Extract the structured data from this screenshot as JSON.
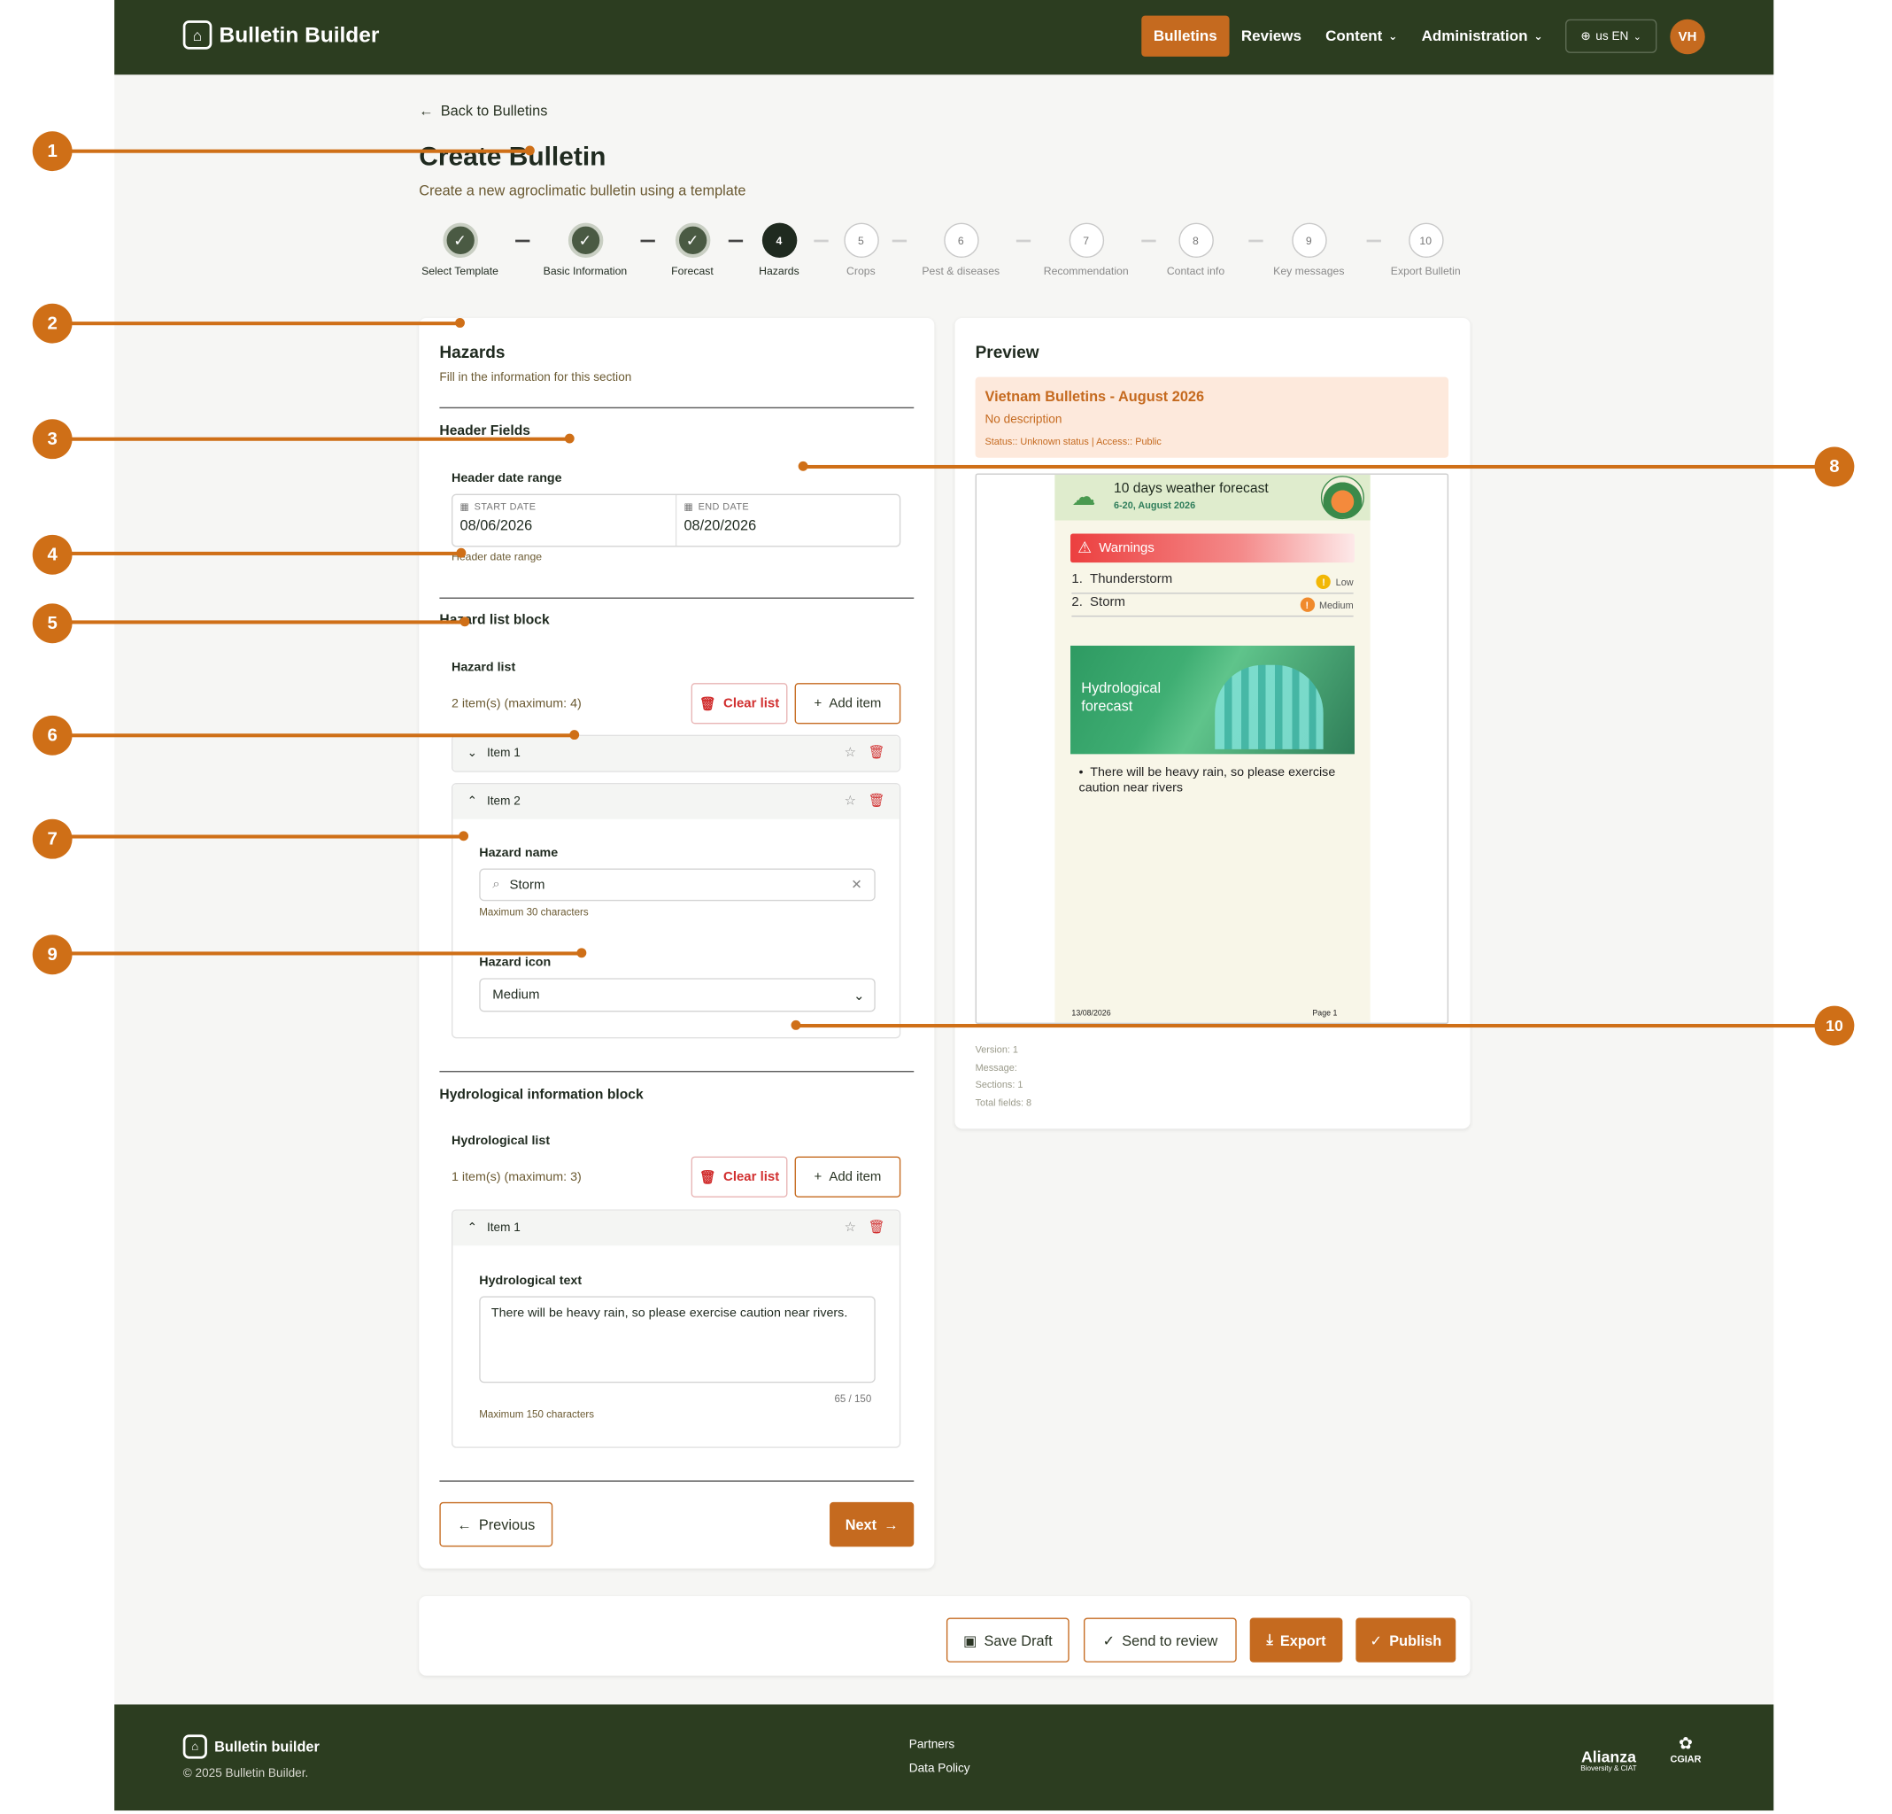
{
  "header": {
    "brand": "Bulletin Builder",
    "nav": [
      {
        "label": "Bulletins",
        "active": true
      },
      {
        "label": "Reviews"
      },
      {
        "label": "Content",
        "dropdown": true
      },
      {
        "label": "Administration",
        "dropdown": true
      }
    ],
    "language": "us EN",
    "avatar": "VH"
  },
  "page": {
    "back": "Back to Bulletins",
    "title": "Create Bulletin",
    "subtitle": "Create a new agroclimatic bulletin using a template"
  },
  "stepper": [
    {
      "label": "Select Template",
      "state": "done"
    },
    {
      "label": "Basic Information",
      "state": "done"
    },
    {
      "label": "Forecast",
      "state": "done"
    },
    {
      "number": "4",
      "label": "Hazards",
      "state": "current"
    },
    {
      "number": "5",
      "label": "Crops",
      "state": "todo"
    },
    {
      "number": "6",
      "label": "Pest & diseases",
      "state": "todo"
    },
    {
      "number": "7",
      "label": "Recommendation",
      "state": "todo"
    },
    {
      "number": "8",
      "label": "Contact info",
      "state": "todo"
    },
    {
      "number": "9",
      "label": "Key messages",
      "state": "todo"
    },
    {
      "number": "10",
      "label": "Export Bulletin",
      "state": "todo"
    }
  ],
  "form": {
    "section_title": "Hazards",
    "section_hint": "Fill in the information for this section",
    "header_fields_title": "Header Fields",
    "header_range_label": "Header date range",
    "start_label": "START DATE",
    "start_value": "08/06/2026",
    "end_label": "END DATE",
    "end_value": "08/20/2026",
    "header_range_hint": "Header date range",
    "hazard_block_title": "Hazard list block",
    "hazard_list_label": "Hazard list",
    "hazard_count": "2 item(s) (maximum: 4)",
    "clear_label": "Clear list",
    "add_label": "Add item",
    "hazard_items": [
      {
        "label": "Item 1",
        "expanded": false
      },
      {
        "label": "Item 2",
        "expanded": true
      }
    ],
    "hazard_name_label": "Hazard name",
    "hazard_name_value": "Storm",
    "hazard_name_hint": "Maximum 30 characters",
    "hazard_icon_label": "Hazard icon",
    "hazard_icon_value": "Medium",
    "hydro_block_title": "Hydrological information block",
    "hydro_list_label": "Hydrological list",
    "hydro_count": "1 item(s) (maximum: 3)",
    "hydro_item_label": "Item 1",
    "hydro_text_label": "Hydrological text",
    "hydro_text_value": "There will be heavy rain, so please exercise caution near rivers.",
    "hydro_counter": "65 / 150",
    "hydro_hint": "Maximum 150 characters",
    "prev_label": "Previous",
    "next_label": "Next"
  },
  "preview": {
    "title": "Preview",
    "bulletin_title": "Vietnam Bulletins - August 2026",
    "description": "No description",
    "status": "Status:: Unknown status | Access:: Public",
    "doc": {
      "heading": "10 days weather forecast",
      "dates": "6-20, August 2026",
      "warnings_label": "Warnings",
      "hazards": [
        {
          "num": "1.",
          "name": "Thunderstorm",
          "level": "Low",
          "color": "#f2b705"
        },
        {
          "num": "2.",
          "name": "Storm",
          "level": "Medium",
          "color": "#f08a2c"
        }
      ],
      "hydro_title": "Hydrological forecast",
      "hydro_bullet": "There will be heavy rain, so please exercise caution near rivers",
      "footer_date": "13/08/2026",
      "footer_page": "Page 1"
    },
    "info": [
      "Version: 1",
      "Message:",
      "Sections: 1",
      "Total fields: 8"
    ]
  },
  "actions": {
    "save": "Save Draft",
    "review": "Send to review",
    "export": "Export",
    "publish": "Publish"
  },
  "footer": {
    "brand": "Bulletin builder",
    "copyright": "© 2025 Bulletin Builder.",
    "links": [
      "Partners",
      "Data Policy"
    ],
    "partner1_name": "Alianza",
    "partner1_sub": "Bioversity & CIAT",
    "partner2": "CGIAR"
  },
  "annotations": [
    "1",
    "2",
    "3",
    "4",
    "5",
    "6",
    "7",
    "8",
    "9",
    "10"
  ],
  "colors": {
    "brand_dark": "#2c3d20",
    "accent": "#c56a1f",
    "danger": "#d12f2f",
    "callout": "#cf6f17"
  }
}
